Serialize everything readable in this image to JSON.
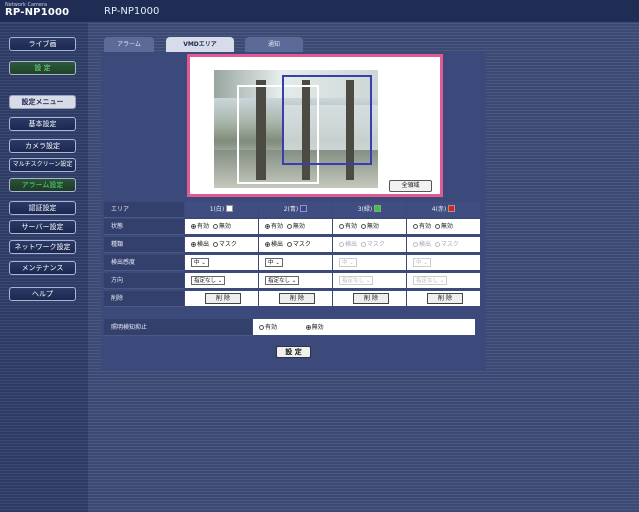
{
  "header": {
    "brand_small": "Network Camera",
    "brand_model": "RP-NP1000",
    "title": "RP-NP1000"
  },
  "sidebar": {
    "live_label": "ライブ画",
    "settings_label": "設 定",
    "menu_label": "設定メニュー",
    "items": [
      {
        "label": "基本設定"
      },
      {
        "label": "カメラ設定"
      },
      {
        "label": "マルチスクリーン設定"
      },
      {
        "label": "アラーム設定"
      },
      {
        "label": "認証設定"
      },
      {
        "label": "サーバー設定"
      },
      {
        "label": "ネットワーク設定"
      },
      {
        "label": "メンテナンス"
      }
    ],
    "help_label": "ヘルプ"
  },
  "tabs": [
    {
      "label": "アラーム"
    },
    {
      "label": "VMDエリア"
    },
    {
      "label": "通知"
    }
  ],
  "preview": {
    "all_area_label": "全領域"
  },
  "table": {
    "headers": [
      "エリア",
      "1(白)",
      "2(青)",
      "3(緑)",
      "4(赤)"
    ],
    "swatch_colors": [
      "#ffffff",
      "#3a3db0",
      "#33cc33",
      "#e02020"
    ],
    "rows": {
      "status_label": "状態",
      "type_label": "種類",
      "sensitivity_label": "検出感度",
      "direction_label": "方向",
      "delete_label": "削除"
    },
    "status_options": [
      "有効",
      "無効"
    ],
    "type_options": [
      "検出",
      "マスク"
    ],
    "sensitivity_value": "中",
    "direction_value": "指定なし",
    "delete_button": "削 除"
  },
  "light": {
    "label": "照明検知抑止",
    "options": [
      "有効",
      "無効"
    ]
  },
  "submit": {
    "label": "設 定"
  }
}
